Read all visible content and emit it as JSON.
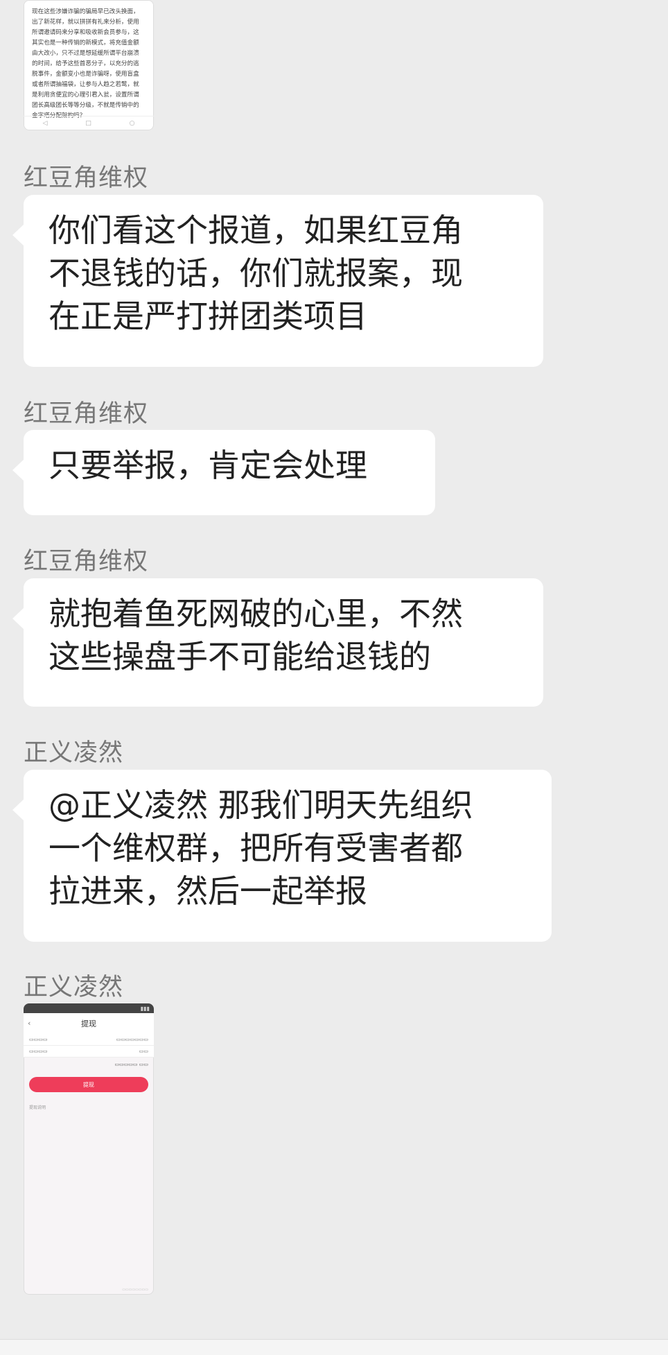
{
  "messages": [
    {
      "type": "image",
      "kind": "article",
      "text": "现在这些涉嫌诈骗的骗局早已改头换面，\n出了新花样，就以拼拼有礼来分析，使用\n所谓邀请码来分享和吸收新会员参与，这\n其实也是一种传销的新模式，将充值金额\n由大改小，只不过是想延缓所谓平台崩溃\n的时间，给予这些首恶分子，以充分的逃\n脱事件，金额变小也是诈骗呀，使用盲盒\n或者所谓抽福袋，让参与人趋之若鹜，就\n是利用贪便宜的心理引君入瓮，设置所谓\n团长高级团长等等分级，不就是传销中的\n金字塔分配架构吗？"
    },
    {
      "type": "text",
      "sender": "红豆角维权",
      "lines": [
        "你们看这个报道，如果红豆角",
        "不退钱的话，你们就报案，现",
        "在正是严打拼团类项目"
      ]
    },
    {
      "type": "text",
      "sender": "红豆角维权",
      "lines": [
        "只要举报，肯定会处理"
      ]
    },
    {
      "type": "text",
      "sender": "红豆角维权",
      "lines": [
        "就抱着鱼死网破的心里，不然",
        "这些操盘手不可能给退钱的"
      ]
    },
    {
      "type": "text",
      "sender": "正义凌然",
      "lines": [
        "@正义凌然 那我们明天先组织",
        "一个维权群，把所有受害者都",
        "拉进来，然后一起举报"
      ]
    },
    {
      "type": "image",
      "kind": "phone",
      "sender": "正义凌然",
      "title": "提现",
      "button": "提现",
      "note_head": "提现说明"
    }
  ]
}
